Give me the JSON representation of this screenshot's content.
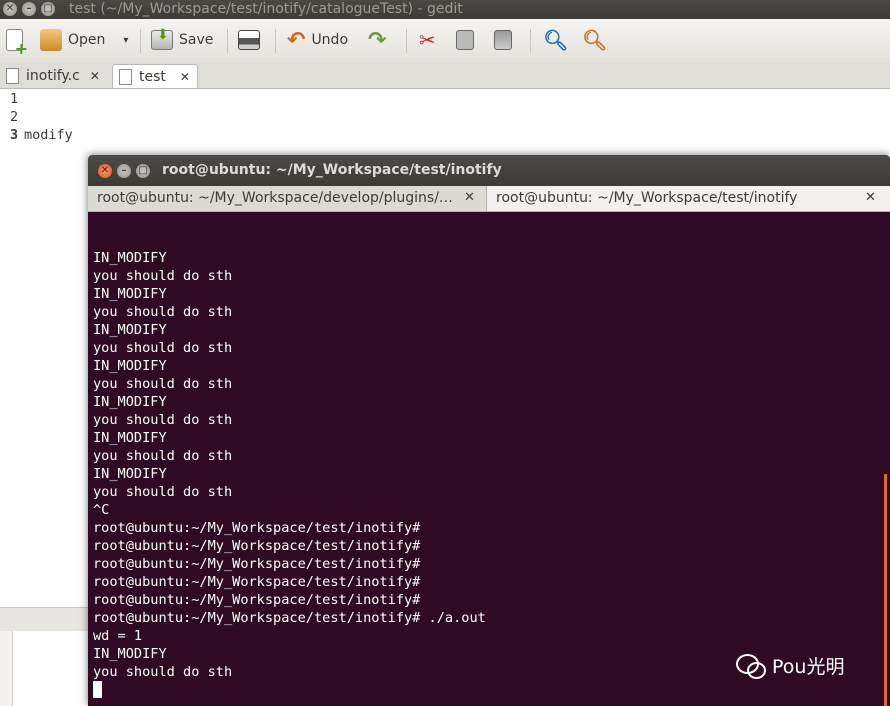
{
  "gedit": {
    "title": "test (~/My_Workspace/test/inotify/catalogueTest) - gedit",
    "toolbar": {
      "open": "Open",
      "save": "Save",
      "undo": "Undo"
    },
    "tabs": [
      {
        "label": "inotify.c",
        "close": "✕"
      },
      {
        "label": "test",
        "close": "✕"
      }
    ],
    "lines": [
      {
        "num": "1",
        "text": ""
      },
      {
        "num": "2",
        "text": ""
      },
      {
        "num": "3",
        "text": "modify"
      }
    ]
  },
  "terminal": {
    "title": "root@ubuntu: ~/My_Workspace/test/inotify",
    "tabs": [
      {
        "label": "root@ubuntu: ~/My_Workspace/develop/plugins/…",
        "close": "✕"
      },
      {
        "label": "root@ubuntu: ~/My_Workspace/test/inotify",
        "close": "✕"
      }
    ],
    "output": [
      "IN_MODIFY",
      "you should do sth",
      "IN_MODIFY",
      "you should do sth",
      "IN_MODIFY",
      "you should do sth",
      "IN_MODIFY",
      "you should do sth",
      "IN_MODIFY",
      "you should do sth",
      "IN_MODIFY",
      "you should do sth",
      "IN_MODIFY",
      "you should do sth",
      "^C",
      "root@ubuntu:~/My_Workspace/test/inotify#",
      "root@ubuntu:~/My_Workspace/test/inotify#",
      "root@ubuntu:~/My_Workspace/test/inotify#",
      "root@ubuntu:~/My_Workspace/test/inotify#",
      "root@ubuntu:~/My_Workspace/test/inotify#",
      "root@ubuntu:~/My_Workspace/test/inotify# ./a.out",
      "wd = 1",
      "IN_MODIFY",
      "you should do sth"
    ]
  },
  "watermark": "Pou光明",
  "colors": {
    "terminal_bg": "#300a24",
    "close_button": "#e05a1c",
    "scroll_accent": "#e36b1f"
  }
}
